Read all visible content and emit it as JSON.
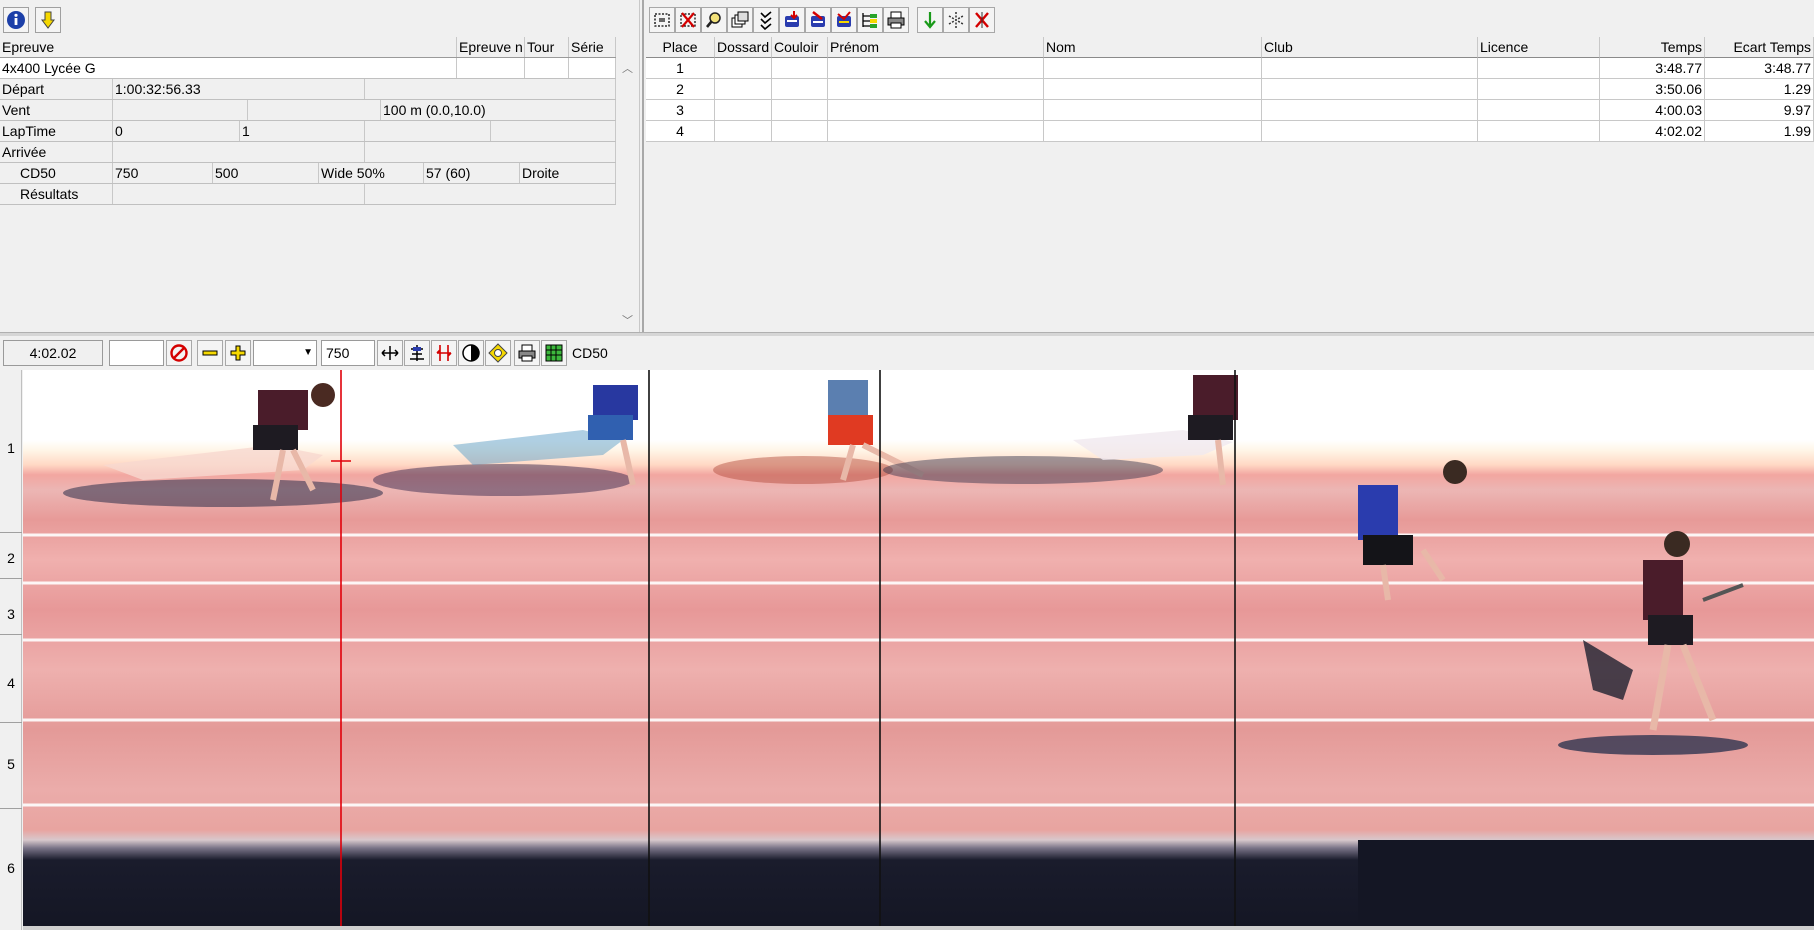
{
  "left_panel": {
    "columns": [
      "Epreuve",
      "Epreuve n",
      "Tour",
      "Série"
    ],
    "event_name": "4x400 Lycée G",
    "rows": [
      {
        "label": "Départ",
        "values": [
          "1:00:32:56.33",
          "",
          ""
        ]
      },
      {
        "label": "Vent",
        "values": [
          "",
          "",
          "100 m (0.0,10.0)"
        ]
      },
      {
        "label": "LapTime",
        "values": [
          "0",
          "1",
          "",
          ""
        ]
      },
      {
        "label": "Arrivée",
        "values": [
          "",
          ""
        ]
      },
      {
        "label": "CD50",
        "values": [
          "750",
          "500",
          "Wide 50%",
          "57  (60)",
          "Droite"
        ]
      },
      {
        "label": "Résultats",
        "values": [
          "",
          ""
        ]
      }
    ]
  },
  "results": {
    "columns": [
      "Place",
      "Dossard",
      "Couloir",
      "Prénom",
      "Nom",
      "Club",
      "Licence",
      "Temps",
      "Ecart Temps"
    ],
    "rows": [
      {
        "place": "1",
        "dossard": "",
        "couloir": "",
        "prenom": "",
        "nom": "",
        "club": "",
        "licence": "",
        "temps": "3:48.77",
        "ecart": "3:48.77"
      },
      {
        "place": "2",
        "dossard": "",
        "couloir": "",
        "prenom": "",
        "nom": "",
        "club": "",
        "licence": "",
        "temps": "3:50.06",
        "ecart": "1.29"
      },
      {
        "place": "3",
        "dossard": "",
        "couloir": "",
        "prenom": "",
        "nom": "",
        "club": "",
        "licence": "",
        "temps": "4:00.03",
        "ecart": "9.97"
      },
      {
        "place": "4",
        "dossard": "",
        "couloir": "",
        "prenom": "",
        "nom": "",
        "club": "",
        "licence": "",
        "temps": "4:02.02",
        "ecart": "1.99"
      }
    ]
  },
  "image_toolbar": {
    "time_display": "4:02.02",
    "time_input": "",
    "zoom_select": "",
    "density_value": "750",
    "camera_label": "CD50"
  },
  "lanes": [
    "1",
    "2",
    "3",
    "4",
    "5",
    "6"
  ],
  "colors": {
    "cursor_line": "#e0000a",
    "time_marker_line": "#111111",
    "info_icon": "#1c3fa8",
    "arrow_icon": "#f5d800",
    "delete_icon": "#d40000"
  },
  "icons": {
    "left_toolbar": [
      "info-icon",
      "download-arrow-icon"
    ],
    "right_toolbar": [
      "select-area-icon",
      "delete-area-icon",
      "zoom-icon",
      "windows-icon",
      "check-list-icon",
      "import-icon",
      "export-icon",
      "merge-icon",
      "tree-icon",
      "print-icon",
      "accept-icon",
      "split-icon",
      "reject-icon"
    ],
    "image_toolbar": [
      "stop-icon",
      "minus-icon",
      "plus-icon",
      "fit-width-icon",
      "align-icon",
      "cut-icon",
      "contrast-icon",
      "brightness-icon",
      "print-icon",
      "grid-icon"
    ]
  }
}
